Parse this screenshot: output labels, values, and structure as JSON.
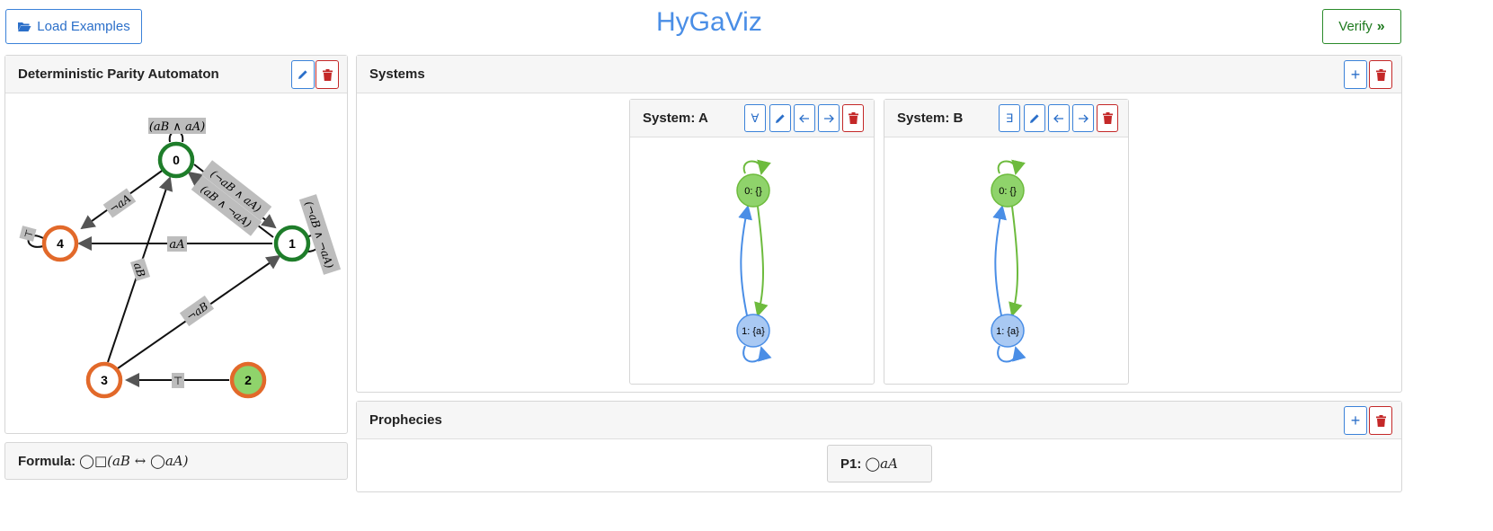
{
  "app": {
    "title": "HyGaViz"
  },
  "toolbar": {
    "load_examples_label": "Load Examples",
    "verify_label": "Verify"
  },
  "automaton": {
    "title": "Deterministic Parity Automaton",
    "nodes": [
      {
        "id": "0",
        "label": "0",
        "color": "green"
      },
      {
        "id": "1",
        "label": "1",
        "color": "green"
      },
      {
        "id": "2",
        "label": "2",
        "color": "green-filled"
      },
      {
        "id": "3",
        "label": "3",
        "color": "orange"
      },
      {
        "id": "4",
        "label": "4",
        "color": "orange"
      }
    ],
    "edge_labels": {
      "e0_self": "(aB ∧ aA)",
      "e0_4": "¬aA",
      "e0_1": "(¬aB ∧ aA)",
      "e1_0": "(aB ∧ ¬aA)",
      "e1_self": "(¬aB ∧ ¬aA)",
      "e1_4": "aA",
      "e3_0": "aB",
      "e3_1": "¬aB",
      "e2_3": "⊤",
      "e4_self": "⊤"
    }
  },
  "formula": {
    "label": "Formula:",
    "text": "◯□(aB ↔ ◯aA)"
  },
  "systems": {
    "title": "Systems",
    "items": [
      {
        "title": "System: A",
        "quantifier": "∀",
        "states": [
          {
            "label": "0: {}",
            "color": "#8fd36b"
          },
          {
            "label": "1: {a}",
            "color": "#a9c9f3"
          }
        ]
      },
      {
        "title": "System: B",
        "quantifier": "∃",
        "states": [
          {
            "label": "0: {}",
            "color": "#8fd36b"
          },
          {
            "label": "1: {a}",
            "color": "#a9c9f3"
          }
        ]
      }
    ]
  },
  "prophecies": {
    "title": "Prophecies",
    "items": [
      {
        "label": "P1:",
        "formula": "◯aA"
      }
    ]
  },
  "colors": {
    "primary": "#3b82d9",
    "title_blue": "#4a8ee6",
    "success": "#2a8a2a",
    "danger": "#c42828",
    "accepting_green": "#1e7d2a",
    "rejecting_orange": "#e2692a",
    "state_green": "#8fd36b",
    "state_blue": "#a9c9f3"
  }
}
